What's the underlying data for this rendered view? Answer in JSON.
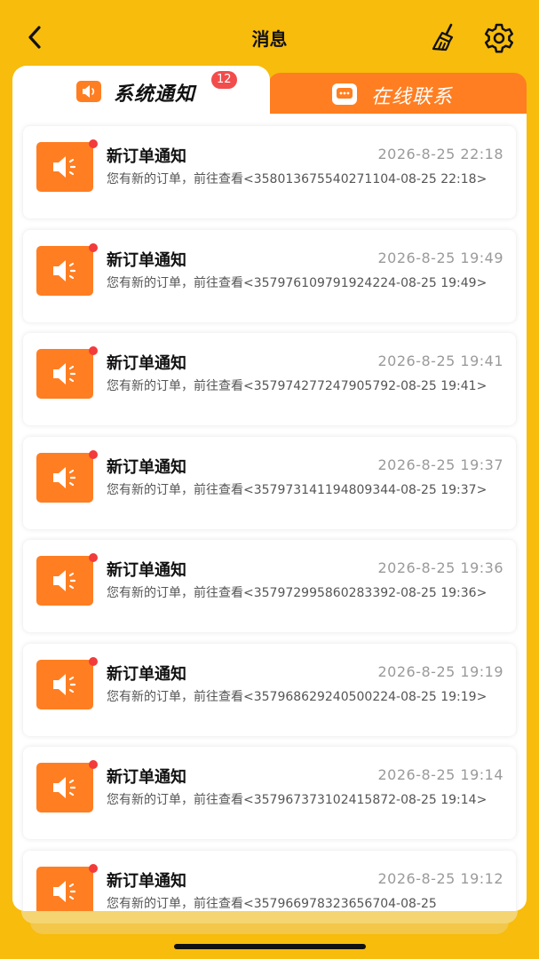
{
  "header": {
    "title": "消息"
  },
  "tabs": [
    {
      "label": "系统通知",
      "badge": "12",
      "active": true,
      "icon": "speaker-icon"
    },
    {
      "label": "在线联系",
      "active": false,
      "icon": "chat-bubble-icon"
    }
  ],
  "notifications": [
    {
      "title": "新订单通知",
      "time": "2026-8-25 22:18",
      "body": "您有新的订单，前往查看<358013675540271104-08-25 22:18>"
    },
    {
      "title": "新订单通知",
      "time": "2026-8-25 19:49",
      "body": "您有新的订单，前往查看<357976109791924224-08-25 19:49>"
    },
    {
      "title": "新订单通知",
      "time": "2026-8-25 19:41",
      "body": "您有新的订单，前往查看<357974277247905792-08-25 19:41>"
    },
    {
      "title": "新订单通知",
      "time": "2026-8-25 19:37",
      "body": "您有新的订单，前往查看<357973141194809344-08-25 19:37>"
    },
    {
      "title": "新订单通知",
      "time": "2026-8-25 19:36",
      "body": "您有新的订单，前往查看<357972995860283392-08-25 19:36>"
    },
    {
      "title": "新订单通知",
      "time": "2026-8-25 19:19",
      "body": "您有新的订单，前往查看<357968629240500224-08-25 19:19>"
    },
    {
      "title": "新订单通知",
      "time": "2026-8-25 19:14",
      "body": "您有新的订单，前往查看<357967373102415872-08-25 19:14>"
    },
    {
      "title": "新订单通知",
      "time": "2026-8-25 19:12",
      "body": "您有新的订单，前往查看<357966978323656704-08-25"
    }
  ],
  "colors": {
    "background": "#F7BC0C",
    "accent": "#FF7E22",
    "badge": "#F24C4C",
    "unread_dot": "#F23B3B"
  }
}
